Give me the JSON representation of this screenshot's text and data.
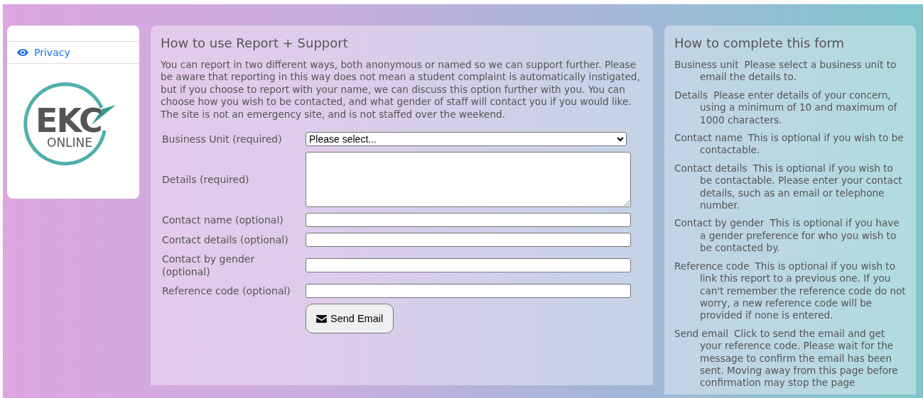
{
  "sidebar": {
    "items": [
      {
        "label": "Privacy"
      }
    ],
    "logo": {
      "wordmark": "EKC",
      "subtitle": "ONLINE"
    }
  },
  "report": {
    "title": "How to use Report + Support",
    "intro": "You can report in two different ways, both anonymous or named so we can support further. Please be aware that reporting in this way does not mean a student complaint is automatically instigated, but if you choose to report with your name, we can discuss this option further with you. You can choose how you wish to be contacted, and what gender of staff will contact you if you would like. The site is not an emergency site, and is not staffed over the weekend.",
    "fields": [
      {
        "label": "Business Unit (required)",
        "kind": "select",
        "value": "Please select..."
      },
      {
        "label": "Details (required)",
        "kind": "textarea"
      },
      {
        "label": "Contact name (optional)",
        "kind": "input"
      },
      {
        "label": "Contact details (optional)",
        "kind": "input"
      },
      {
        "label": "Contact by gender (optional)",
        "kind": "input"
      },
      {
        "label": "Reference code (optional)",
        "kind": "input"
      }
    ],
    "submit": "Send Email"
  },
  "help": {
    "title": "How to complete this form",
    "entries": [
      {
        "term": "Business unit",
        "text": "Please select a business unit to email the details to."
      },
      {
        "term": "Details",
        "text": "Please enter details of your concern, using a minimum of 10 and maximum of 1000 characters."
      },
      {
        "term": "Contact name",
        "text": "This is optional if you wish to be contactable."
      },
      {
        "term": "Contact details",
        "text": "This is optional if you wish to be contactable. Please enter your contact details, such as an email or telephone number."
      },
      {
        "term": "Contact by gender",
        "text": "This is optional if you have a gender preference for who you wish to be contacted by."
      },
      {
        "term": "Reference code",
        "text": "This is optional if you wish to link this report to a previous one. If you can't remember the reference code do not worry, a new reference code will be provided if none is entered."
      },
      {
        "term": "Send email",
        "text": "Click to send the email and get your reference code. Please wait for the message to confirm the email has been sent. Moving away from this page before confirmation may stop the page"
      }
    ]
  }
}
